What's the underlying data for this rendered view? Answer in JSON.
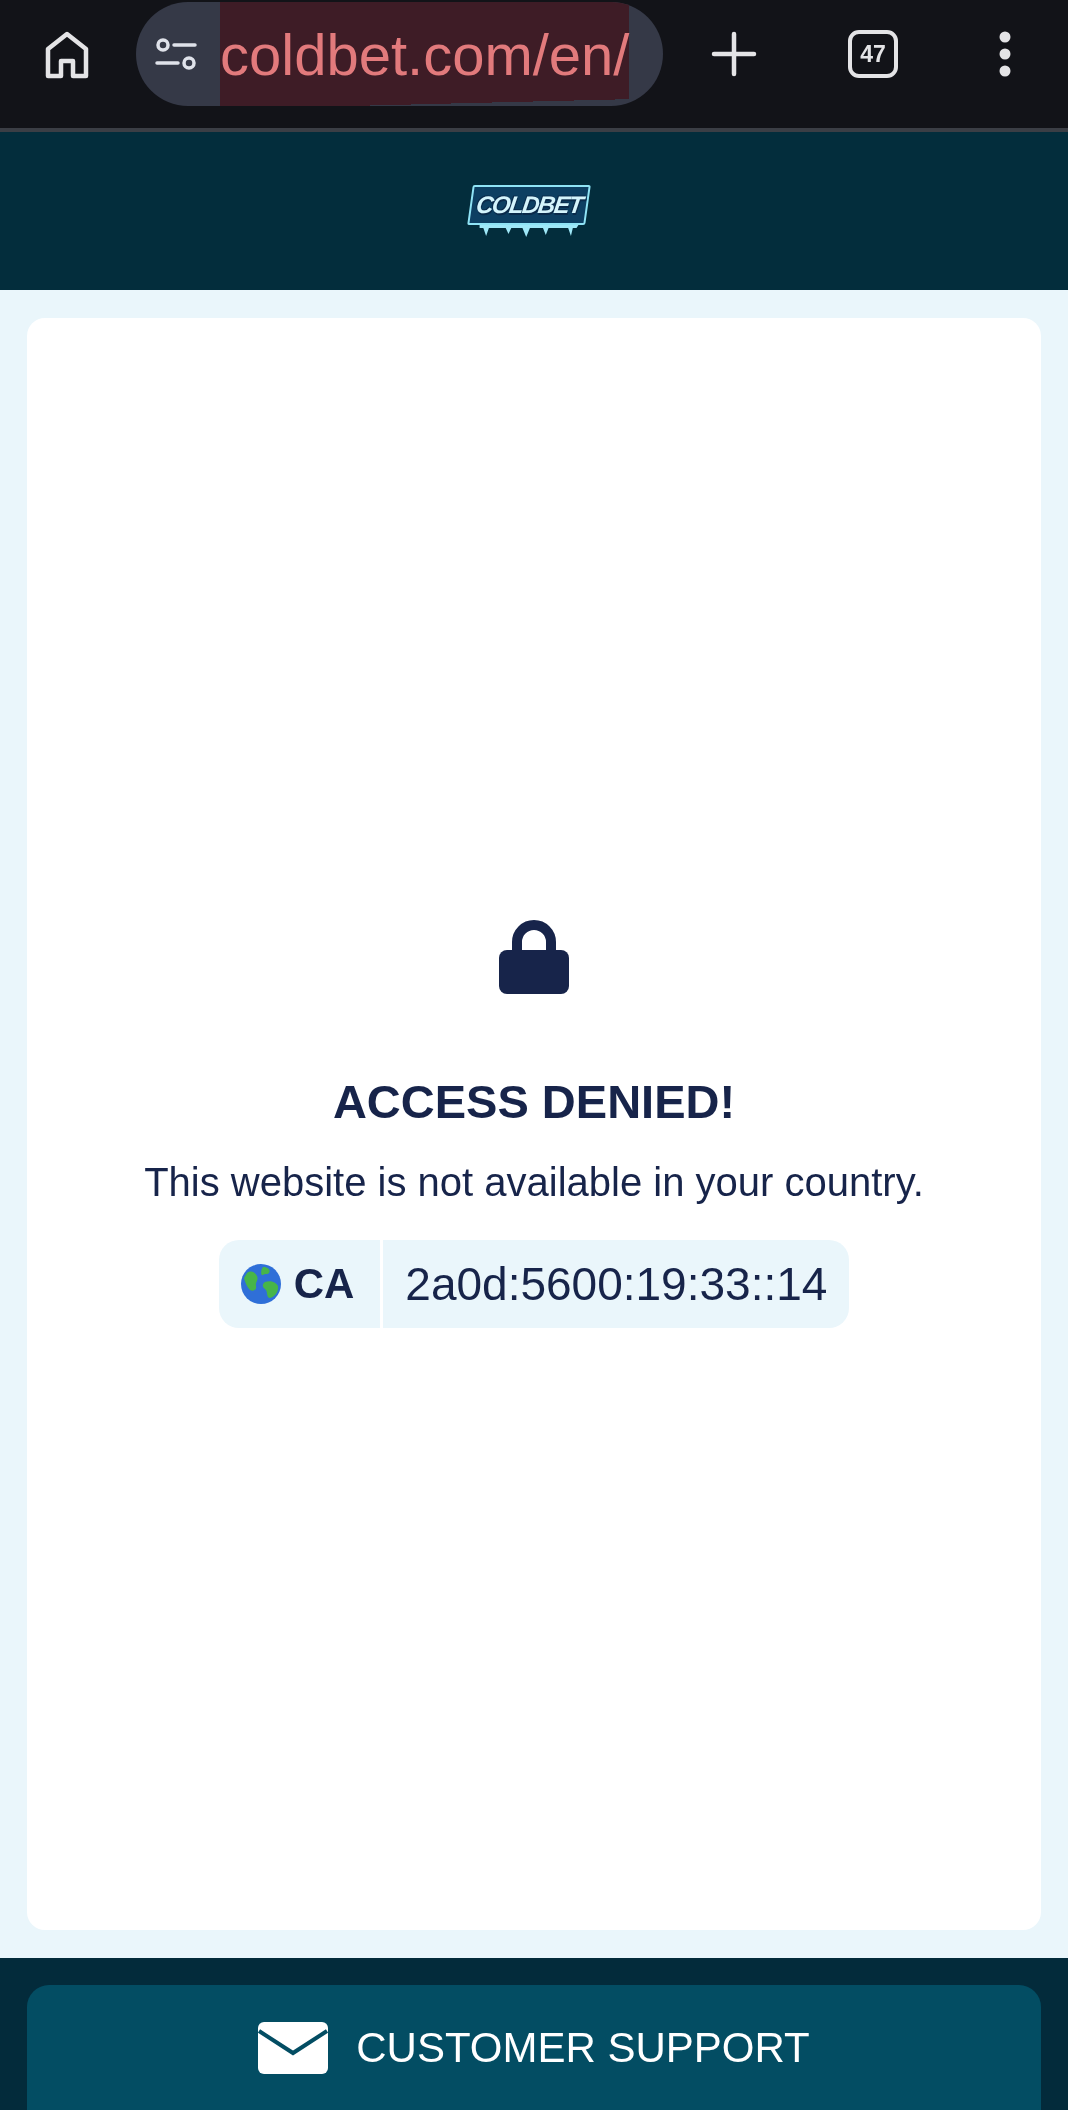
{
  "browser": {
    "url": "coldbet.com/en/",
    "tab_count": "47"
  },
  "header": {
    "logo": "COLDBET"
  },
  "notice": {
    "title": "ACCESS DENIED!",
    "message": "This website is not available in your country.",
    "country_code": "CA",
    "ip_address": "2a0d:5600:19:33::14"
  },
  "footer": {
    "support_button": "CUSTOMER SUPPORT"
  }
}
